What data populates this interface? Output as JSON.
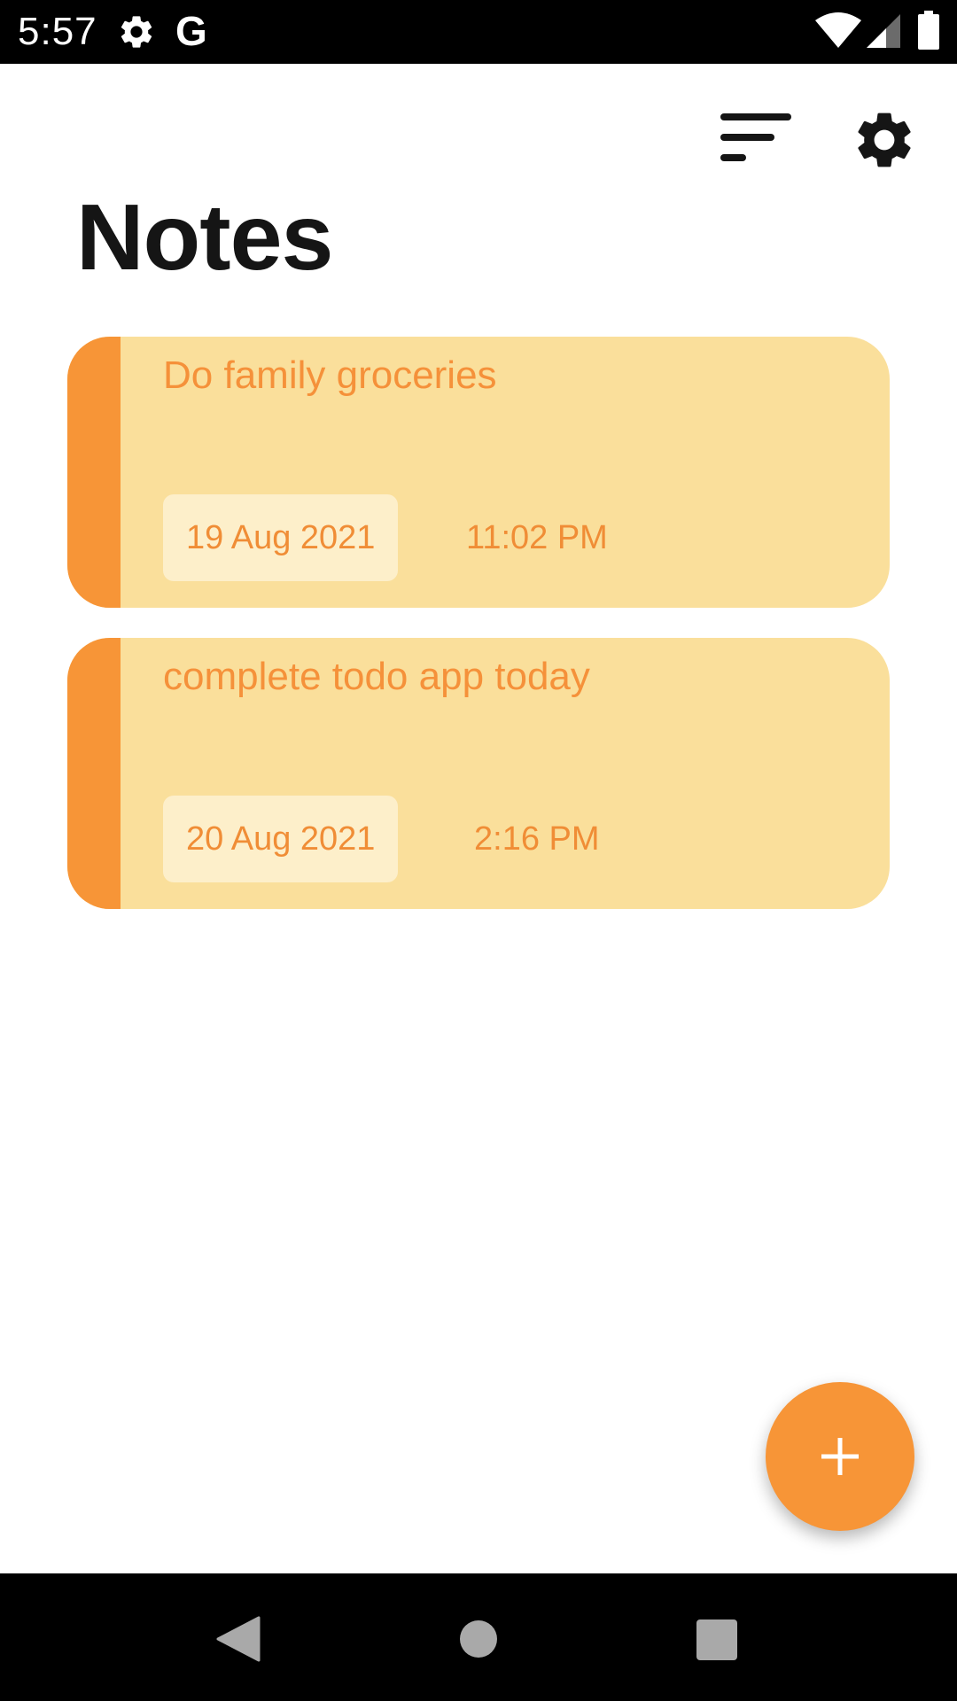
{
  "status_bar": {
    "time": "5:57",
    "g_label": "G",
    "icons": [
      "gear-icon",
      "google-icon",
      "wifi-icon",
      "signal-icon",
      "battery-icon"
    ]
  },
  "app_bar": {
    "title": "Notes",
    "sort_icon": "sort-icon",
    "settings_icon": "settings-icon"
  },
  "notes": [
    {
      "title": "Do family groceries",
      "date": "19 Aug 2021",
      "time": "11:02 PM"
    },
    {
      "title": "complete todo app today",
      "date": "20 Aug 2021",
      "time": "2:16 PM"
    }
  ],
  "fab": {
    "icon": "plus-icon"
  },
  "nav_bar": {
    "icons": [
      "back-icon",
      "home-icon",
      "recents-icon"
    ]
  },
  "colors": {
    "accent": "#f79537",
    "card_background": "#fadf9b",
    "date_chip_background": "#fdefca",
    "note_text": "#f5913a",
    "title_text": "#151515"
  }
}
